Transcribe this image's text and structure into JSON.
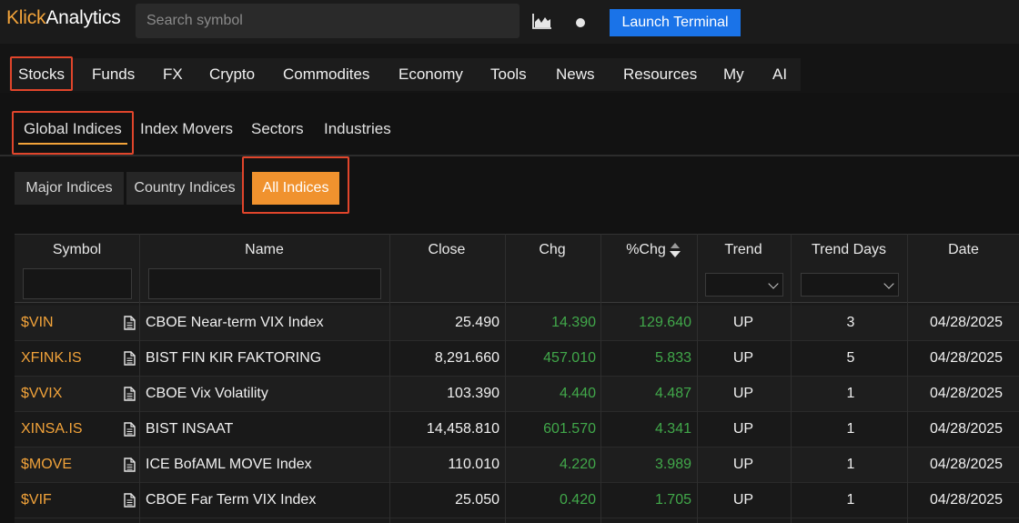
{
  "brand": {
    "part1": "Klick",
    "part2": "Analytics"
  },
  "search": {
    "placeholder": "Search symbol"
  },
  "header": {
    "launch_label": "Launch Terminal"
  },
  "main_nav": [
    "Stocks",
    "Funds",
    "FX",
    "Crypto",
    "Commodites",
    "Economy",
    "Tools",
    "News",
    "Resources",
    "My",
    "AI"
  ],
  "sub_nav": [
    "Global Indices",
    "Index Movers",
    "Sectors",
    "Industries"
  ],
  "filters": [
    "Major Indices",
    "Country Indices",
    "All Indices"
  ],
  "active_filter": "All Indices",
  "colors": {
    "accent": "#f2a33a",
    "active_button": "#f0922e",
    "launch_button": "#1a73e8",
    "positive": "#41a84a",
    "highlight": "#e0452b"
  },
  "table": {
    "columns": [
      "Symbol",
      "Name",
      "Close",
      "Chg",
      "%Chg",
      "Trend",
      "Trend Days",
      "Date"
    ],
    "sort_column": "%Chg",
    "rows": [
      {
        "symbol": "$VIN",
        "name": "CBOE Near-term VIX Index",
        "close": "25.490",
        "chg": "14.390",
        "pchg": "129.640",
        "trend": "UP",
        "days": "3",
        "date": "04/28/2025"
      },
      {
        "symbol": "XFINK.IS",
        "name": "BIST FIN KIR FAKTORING",
        "close": "8,291.660",
        "chg": "457.010",
        "pchg": "5.833",
        "trend": "UP",
        "days": "5",
        "date": "04/28/2025"
      },
      {
        "symbol": "$VVIX",
        "name": "CBOE Vix Volatility",
        "close": "103.390",
        "chg": "4.440",
        "pchg": "4.487",
        "trend": "UP",
        "days": "1",
        "date": "04/28/2025"
      },
      {
        "symbol": "XINSA.IS",
        "name": "BIST INSAAT",
        "close": "14,458.810",
        "chg": "601.570",
        "pchg": "4.341",
        "trend": "UP",
        "days": "1",
        "date": "04/28/2025"
      },
      {
        "symbol": "$MOVE",
        "name": "ICE BofAML MOVE Index",
        "close": "110.010",
        "chg": "4.220",
        "pchg": "3.989",
        "trend": "UP",
        "days": "1",
        "date": "04/28/2025"
      },
      {
        "symbol": "$VIF",
        "name": "CBOE Far Term VIX Index",
        "close": "25.050",
        "chg": "0.420",
        "pchg": "1.705",
        "trend": "UP",
        "days": "1",
        "date": "04/28/2025"
      }
    ]
  }
}
